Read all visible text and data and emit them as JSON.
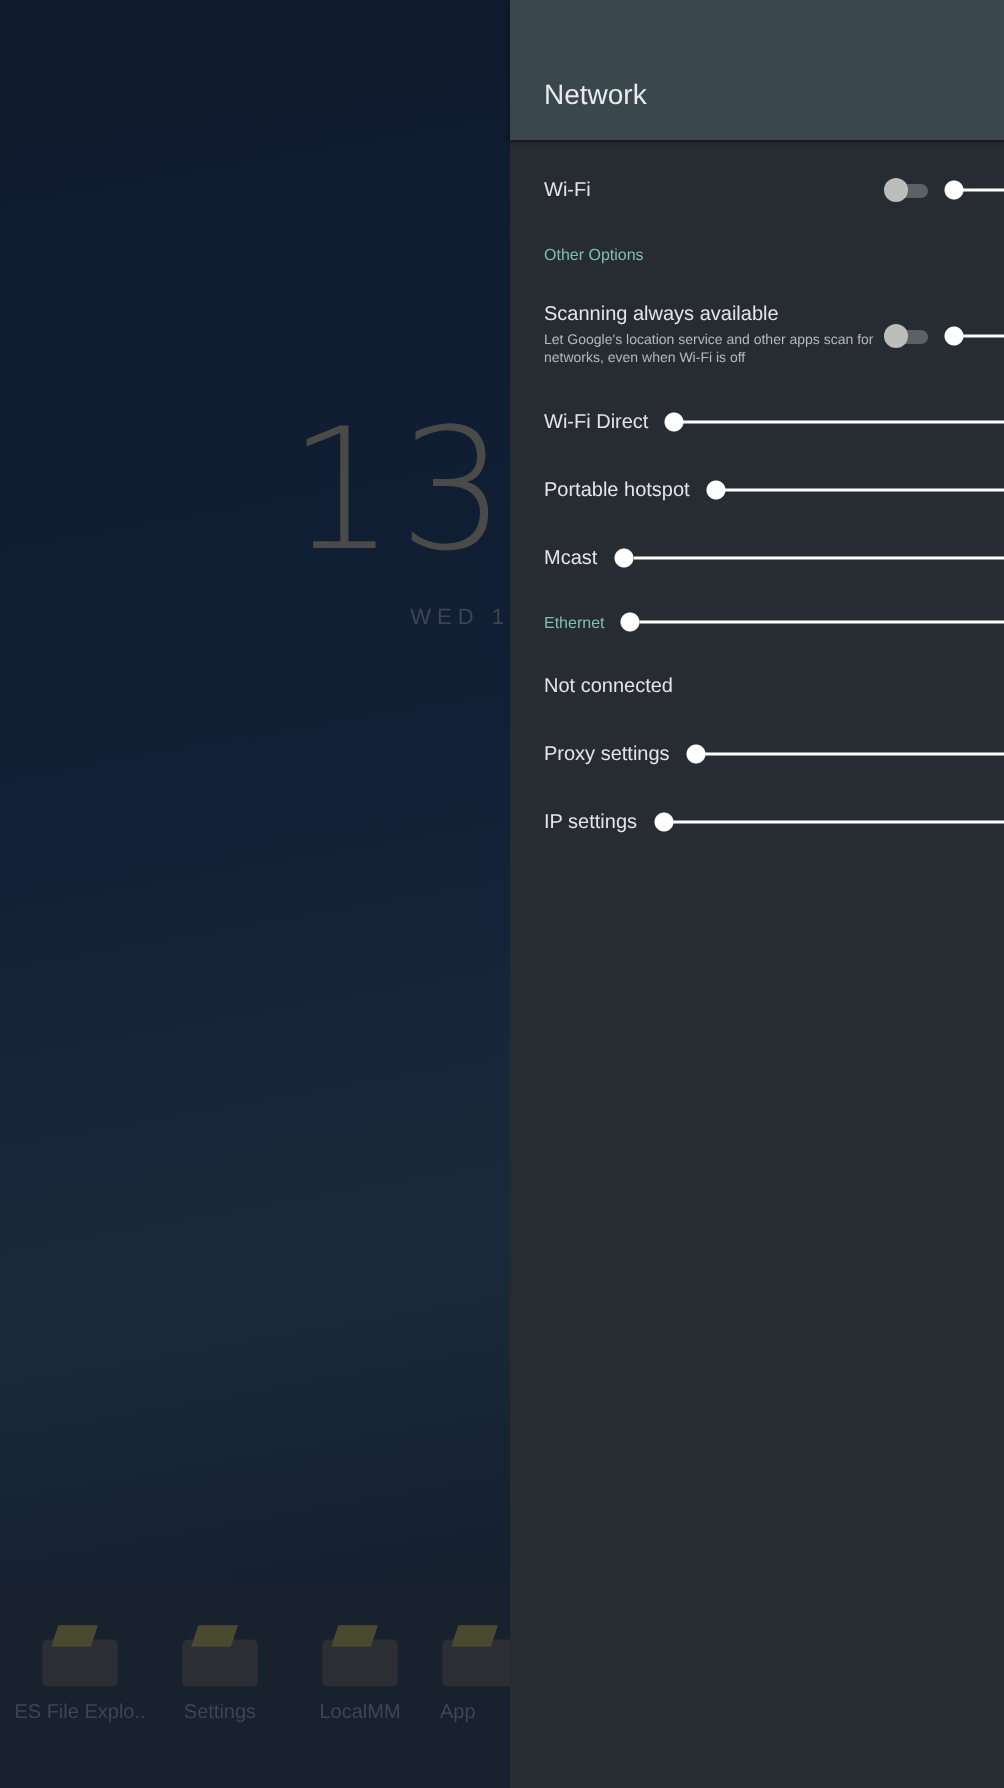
{
  "home_screen": {
    "clock": "13",
    "date": "WED 1",
    "dock": [
      {
        "label": "ES File Explo.."
      },
      {
        "label": "Settings"
      },
      {
        "label": "LocalMM"
      },
      {
        "label": "App"
      }
    ]
  },
  "panel": {
    "title": "Network",
    "items": [
      {
        "kind": "toggle",
        "label": "Wi-Fi",
        "on": false,
        "callout": true
      },
      {
        "kind": "header",
        "label": "Other Options",
        "callout": false
      },
      {
        "kind": "toggle",
        "label": "Scanning always available",
        "summary": "Let Google's location service and other apps scan for networks, even when Wi-Fi is off",
        "on": false,
        "callout": true
      },
      {
        "kind": "item",
        "label": "Wi-Fi Direct",
        "callout": true
      },
      {
        "kind": "item",
        "label": "Portable hotspot",
        "callout": true
      },
      {
        "kind": "item",
        "label": "Mcast",
        "callout": true
      },
      {
        "kind": "header",
        "label": "Ethernet",
        "callout": true
      },
      {
        "kind": "item",
        "label": "Not connected",
        "callout": false
      },
      {
        "kind": "item",
        "label": "Proxy settings",
        "callout": true
      },
      {
        "kind": "item",
        "label": "IP settings",
        "callout": true
      }
    ]
  }
}
